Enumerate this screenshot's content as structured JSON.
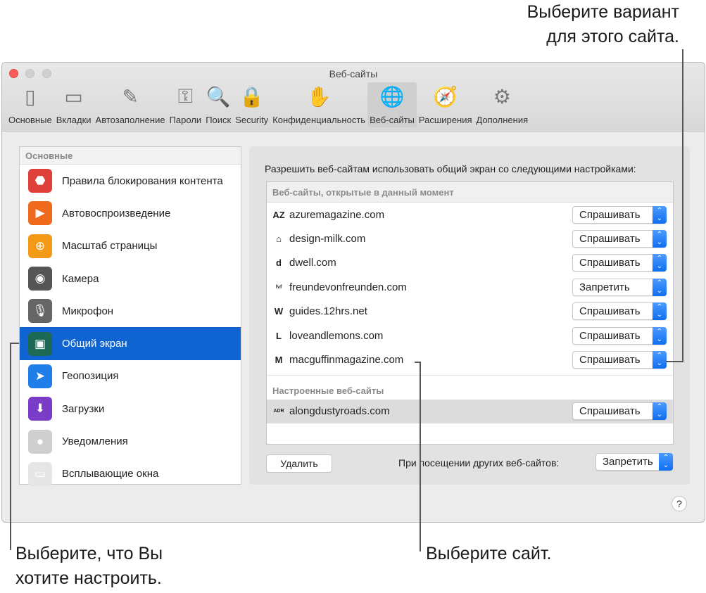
{
  "callouts": {
    "top_line1": "Выберите вариант",
    "top_line2": "для этого сайта.",
    "left_line1": "Выберите, что Вы",
    "left_line2": "хотите настроить.",
    "middle": "Выберите сайт."
  },
  "window": {
    "title": "Веб-сайты"
  },
  "toolbar": [
    {
      "label": "Основные",
      "icon": "switch-icon",
      "glyph": "▯"
    },
    {
      "label": "Вкладки",
      "icon": "tabs-icon",
      "glyph": "▭"
    },
    {
      "label": "Автозаполнение",
      "icon": "pencil-icon",
      "glyph": "✎"
    },
    {
      "label": "Пароли",
      "icon": "key-icon",
      "glyph": "⚿"
    },
    {
      "label": "Поиск",
      "icon": "magnifier-icon",
      "glyph": "🔍"
    },
    {
      "label": "Security",
      "icon": "lock-icon",
      "glyph": "🔒"
    },
    {
      "label": "Конфиденциальность",
      "icon": "hand-icon",
      "glyph": "✋"
    },
    {
      "label": "Веб-сайты",
      "icon": "globe-icon",
      "glyph": "🌐",
      "selected": true
    },
    {
      "label": "Расширения",
      "icon": "puzzle-compass-icon",
      "glyph": "🧭"
    },
    {
      "label": "Дополнения",
      "icon": "gear-icon",
      "glyph": "⚙"
    }
  ],
  "sidebar": {
    "header": "Основные",
    "items": [
      {
        "label": "Правила блокирования контента",
        "icon": "stop-sign-icon",
        "color": "#e0403a",
        "glyph": "⬣"
      },
      {
        "label": "Автовоспроизведение",
        "icon": "play-icon",
        "color": "#f06a1e",
        "glyph": "▶"
      },
      {
        "label": "Масштаб страницы",
        "icon": "zoom-icon",
        "color": "#f29a16",
        "glyph": "⊕"
      },
      {
        "label": "Камера",
        "icon": "camera-icon",
        "color": "#555555",
        "glyph": "◉"
      },
      {
        "label": "Микрофон",
        "icon": "microphone-icon",
        "color": "#666666",
        "glyph": "🎙"
      },
      {
        "label": "Общий экран",
        "icon": "screen-share-icon",
        "color": "#1c6a55",
        "glyph": "▣",
        "selected": true
      },
      {
        "label": "Геопозиция",
        "icon": "location-arrow-icon",
        "color": "#1f7ee8",
        "glyph": "➤"
      },
      {
        "label": "Загрузки",
        "icon": "download-icon",
        "color": "#7a3dc7",
        "glyph": "⬇"
      },
      {
        "label": "Уведомления",
        "icon": "notifications-icon",
        "color": "#cfcfcf",
        "glyph": "●"
      },
      {
        "label": "Всплывающие окна",
        "icon": "popup-window-icon",
        "color": "#e6e6e6",
        "glyph": "▭"
      }
    ]
  },
  "main": {
    "description": "Разрешить веб-сайтам использовать общий экран со следующими настройками:",
    "current_header": "Веб-сайты, открытые в данный момент",
    "current_sites": [
      {
        "site": "azuremagazine.com",
        "fav": "AZ",
        "value": "Спрашивать"
      },
      {
        "site": "design-milk.com",
        "fav": "⌂",
        "value": "Спрашивать"
      },
      {
        "site": "dwell.com",
        "fav": "d",
        "value": "Спрашивать"
      },
      {
        "site": "freundevonfreunden.com",
        "fav": "fvf",
        "value": "Запретить"
      },
      {
        "site": "guides.12hrs.net",
        "fav": "W",
        "value": "Спрашивать"
      },
      {
        "site": "loveandlemons.com",
        "fav": "L",
        "value": "Спрашивать"
      },
      {
        "site": "macguffinmagazine.com",
        "fav": "M",
        "value": "Спрашивать"
      }
    ],
    "configured_header": "Настроенные веб-сайты",
    "configured_sites": [
      {
        "site": "alongdustyroads.com",
        "fav": "ADR",
        "value": "Спрашивать"
      }
    ],
    "remove_button": "Удалить",
    "other_label": "При посещении других веб-сайтов:",
    "other_value": "Запретить",
    "help": "?"
  },
  "colors": {
    "accent": "#0f64d2",
    "popup_arrow": "#1a73f0"
  }
}
